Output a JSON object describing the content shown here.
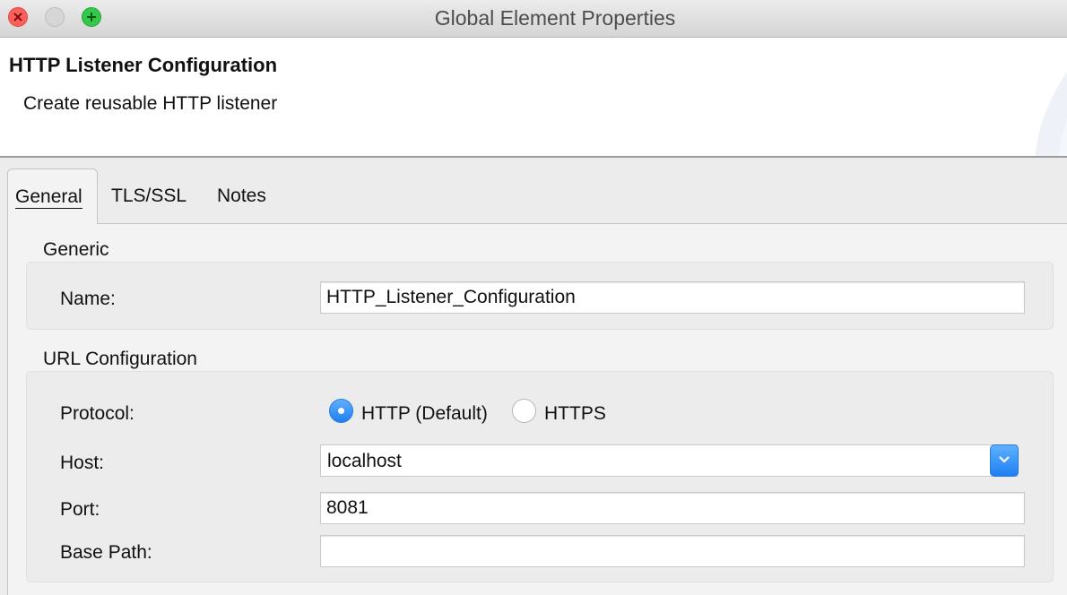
{
  "window": {
    "title": "Global Element Properties"
  },
  "header": {
    "title": "HTTP Listener Configuration",
    "description": "Create reusable HTTP listener"
  },
  "tabs": [
    {
      "label": "General",
      "active": true
    },
    {
      "label": "TLS/SSL",
      "active": false
    },
    {
      "label": "Notes",
      "active": false
    }
  ],
  "generic": {
    "group_label": "Generic",
    "name_label": "Name:",
    "name_value": "HTTP_Listener_Configuration"
  },
  "url_config": {
    "group_label": "URL Configuration",
    "protocol_label": "Protocol:",
    "protocol_options": [
      {
        "label": "HTTP (Default)",
        "selected": true
      },
      {
        "label": "HTTPS",
        "selected": false
      }
    ],
    "host_label": "Host:",
    "host_value": "localhost",
    "port_label": "Port:",
    "port_value": "8081",
    "base_path_label": "Base Path:",
    "base_path_value": ""
  },
  "colors": {
    "accent": "#2a7ad8",
    "close": "#fc605c",
    "maximize": "#34c84a"
  },
  "icons": {
    "close": "close-icon",
    "minimize": "minimize-icon",
    "maximize": "plus-icon",
    "dropdown": "chevron-down-icon"
  }
}
